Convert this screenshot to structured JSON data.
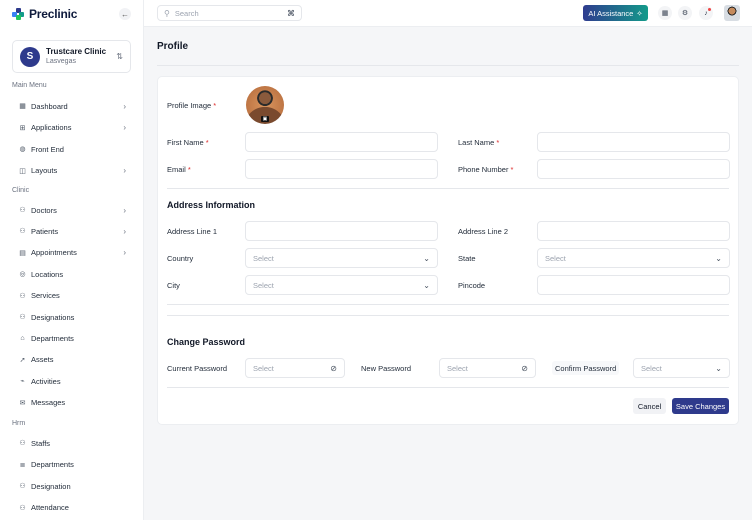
{
  "brand": {
    "name": "Preclinic",
    "colors": [
      "#2e3a8c",
      "#139a8a",
      "#3b82f6",
      "#22c55e"
    ]
  },
  "clinic": {
    "name": "Trustcare Clinic",
    "location": "Lasvegas"
  },
  "sidebar": {
    "main_menu_label": "Main Menu",
    "main_items": [
      {
        "label": "Dashboard",
        "icon": "grid-icon",
        "glyph": "▦",
        "has_chevron": true
      },
      {
        "label": "Applications",
        "icon": "apps-icon",
        "glyph": "⊞",
        "has_chevron": true
      },
      {
        "label": "Front End",
        "icon": "globe-icon",
        "glyph": "◍",
        "has_chevron": false
      },
      {
        "label": "Layouts",
        "icon": "layout-icon",
        "glyph": "◫",
        "has_chevron": true
      }
    ],
    "clinic_label": "Clinic",
    "clinic_items": [
      {
        "label": "Doctors",
        "icon": "user-icon",
        "glyph": "⚇",
        "has_chevron": true
      },
      {
        "label": "Patients",
        "icon": "user-icon",
        "glyph": "⚇",
        "has_chevron": true
      },
      {
        "label": "Appointments",
        "icon": "calendar-icon",
        "glyph": "▤",
        "has_chevron": true
      },
      {
        "label": "Locations",
        "icon": "location-icon",
        "glyph": "◎",
        "has_chevron": false
      },
      {
        "label": "Services",
        "icon": "user-icon",
        "glyph": "⚇",
        "has_chevron": false
      },
      {
        "label": "Designations",
        "icon": "user-icon",
        "glyph": "⚇",
        "has_chevron": false
      },
      {
        "label": "Departments",
        "icon": "department-icon",
        "glyph": "⌂",
        "has_chevron": false
      },
      {
        "label": "Assets",
        "icon": "rocket-icon",
        "glyph": "➚",
        "has_chevron": false
      },
      {
        "label": "Activities",
        "icon": "activity-icon",
        "glyph": "⌁",
        "has_chevron": false
      },
      {
        "label": "Messages",
        "icon": "message-icon",
        "glyph": "✉",
        "has_chevron": false
      }
    ],
    "hrm_label": "Hrm",
    "hrm_items": [
      {
        "label": "Staffs",
        "icon": "users-icon",
        "glyph": "⚇",
        "has_chevron": false
      },
      {
        "label": "Departments",
        "icon": "list-icon",
        "glyph": "≣",
        "has_chevron": false
      },
      {
        "label": "Designation",
        "icon": "user-icon",
        "glyph": "⚇",
        "has_chevron": false
      },
      {
        "label": "Attendance",
        "icon": "user-icon",
        "glyph": "⚇",
        "has_chevron": false
      }
    ]
  },
  "topbar": {
    "search_placeholder": "Search",
    "search_shortcut": "⌘",
    "ai_label": "AI Assistance",
    "ai_glyph": "✧"
  },
  "page": {
    "title": "Profile"
  },
  "profile": {
    "image_label": "Profile Image",
    "first_name_label": "First Name",
    "last_name_label": "Last Name",
    "email_label": "Email",
    "phone_label": "Phone Number",
    "required_mark": "*"
  },
  "address": {
    "section_title": "Address Information",
    "line1_label": "Address Line 1",
    "line2_label": "Address Line 2",
    "country_label": "Country",
    "state_label": "State",
    "city_label": "City",
    "pincode_label": "Pincode",
    "select_placeholder": "Select"
  },
  "password": {
    "section_title": "Change Password",
    "current_label": "Current Password",
    "new_label": "New Password",
    "confirm_label": "Confirm Password",
    "placeholder": "Select"
  },
  "actions": {
    "cancel": "Cancel",
    "save": "Save Changes"
  }
}
